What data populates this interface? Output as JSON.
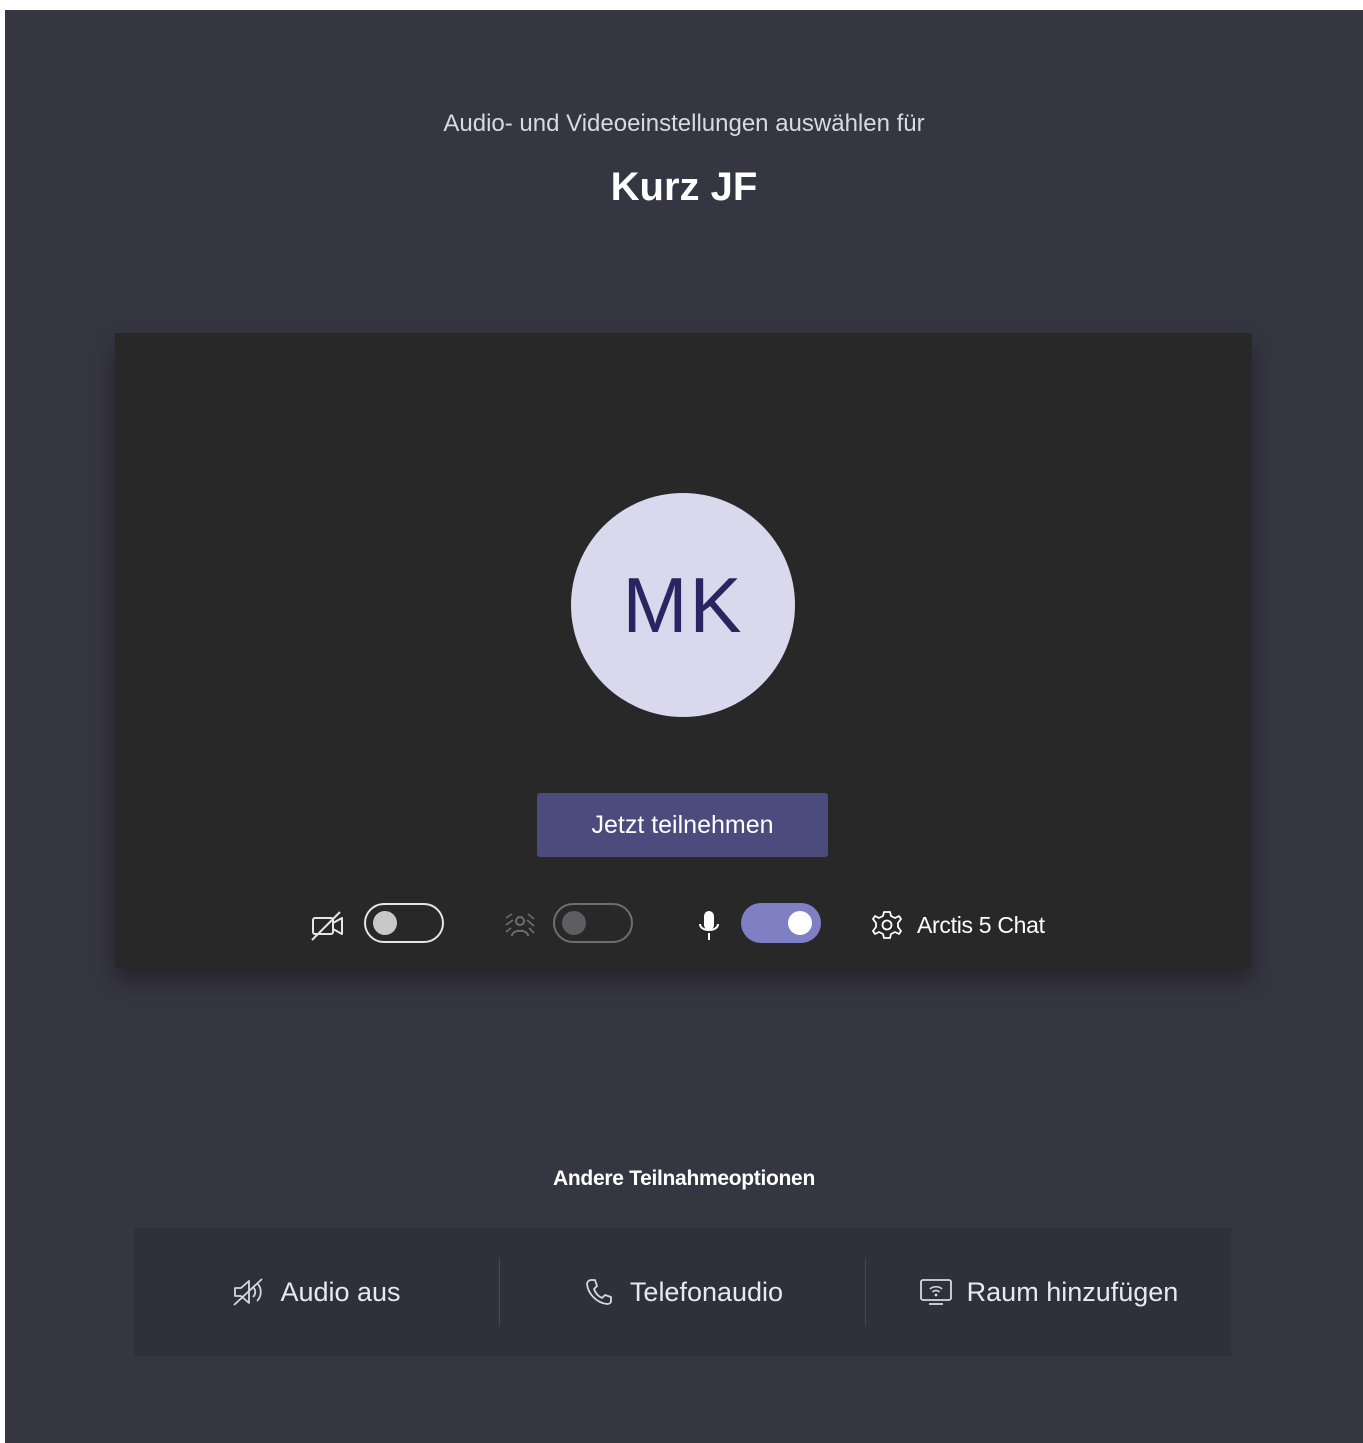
{
  "header": {
    "subtitle": "Audio- und Videoeinstellungen auswählen für",
    "meeting_title": "Kurz JF"
  },
  "preview": {
    "avatar_initials": "MK",
    "join_button_label": "Jetzt teilnehmen",
    "controls": {
      "camera": {
        "icon": "camera-off-icon",
        "state": "off"
      },
      "background_blur": {
        "icon": "background-blur-icon",
        "state": "off",
        "disabled": true
      },
      "microphone": {
        "icon": "microphone-icon",
        "state": "on"
      },
      "device": {
        "icon": "gear-icon",
        "label": "Arctis 5 Chat"
      }
    }
  },
  "other_options": {
    "title": "Andere Teilnahmeoptionen",
    "items": [
      {
        "icon": "speaker-off-icon",
        "label": "Audio aus"
      },
      {
        "icon": "phone-icon",
        "label": "Telefonaudio"
      },
      {
        "icon": "room-cast-icon",
        "label": "Raum hinzufügen"
      }
    ]
  },
  "colors": {
    "background": "#363542",
    "preview_bg": "#292828",
    "accent": "#4c4b7d",
    "toggle_on": "#7f7fc4",
    "avatar_bg": "#d9d8ec",
    "avatar_text": "#2a2560"
  }
}
